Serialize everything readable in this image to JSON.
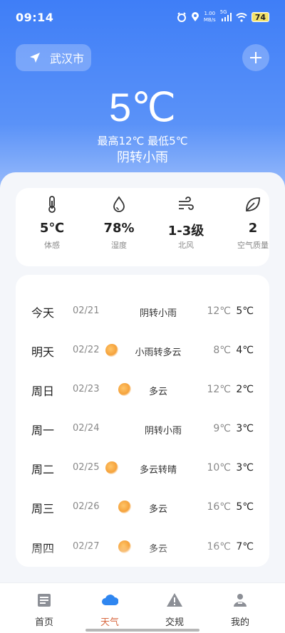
{
  "status_bar": {
    "time": "09:14",
    "net_speed_top": "1.00",
    "net_speed_bottom": "MB/s",
    "signal_label": "5G",
    "battery": "74"
  },
  "location": {
    "city": "武汉市"
  },
  "current": {
    "temperature": "5℃",
    "range": "最高12℃ 最低5℃",
    "condition": "阴转小雨"
  },
  "metrics": [
    {
      "icon": "thermometer-icon",
      "value": "5℃",
      "label": "体感"
    },
    {
      "icon": "water-drop-icon",
      "value": "78%",
      "label": "湿度"
    },
    {
      "icon": "wind-icon",
      "value": "1-3级",
      "label": "北风"
    },
    {
      "icon": "leaf-icon",
      "value": "2",
      "label": "空气质量"
    }
  ],
  "forecast": [
    {
      "day": "今天",
      "date": "02/21",
      "icon": "",
      "desc": "阴转小雨",
      "high": "12℃",
      "low": "5℃"
    },
    {
      "day": "明天",
      "date": "02/22",
      "icon": "partly-cloudy-icon",
      "desc": "小雨转多云",
      "high": "8℃",
      "low": "4℃"
    },
    {
      "day": "周日",
      "date": "02/23",
      "icon": "partly-cloudy-icon",
      "desc": "多云",
      "high": "12℃",
      "low": "2℃"
    },
    {
      "day": "周一",
      "date": "02/24",
      "icon": "",
      "desc": "阴转小雨",
      "high": "9℃",
      "low": "3℃"
    },
    {
      "day": "周二",
      "date": "02/25",
      "icon": "sun-icon",
      "desc": "多云转晴",
      "high": "10℃",
      "low": "3℃"
    },
    {
      "day": "周三",
      "date": "02/26",
      "icon": "partly-cloudy-icon",
      "desc": "多云",
      "high": "16℃",
      "low": "5℃"
    },
    {
      "day": "周四",
      "date": "02/27",
      "icon": "partly-cloudy-icon",
      "desc": "多云",
      "high": "16℃",
      "low": "7℃"
    }
  ],
  "tabs": [
    {
      "label": "首页",
      "icon": "home-icon"
    },
    {
      "label": "天气",
      "icon": "cloud-icon",
      "active": true
    },
    {
      "label": "交规",
      "icon": "warning-icon"
    },
    {
      "label": "我的",
      "icon": "profile-icon"
    }
  ],
  "colors": {
    "accent_blue": "#3f7ef7",
    "active_tab_text": "#d86a43",
    "active_tab_icon": "#2f86f0"
  }
}
